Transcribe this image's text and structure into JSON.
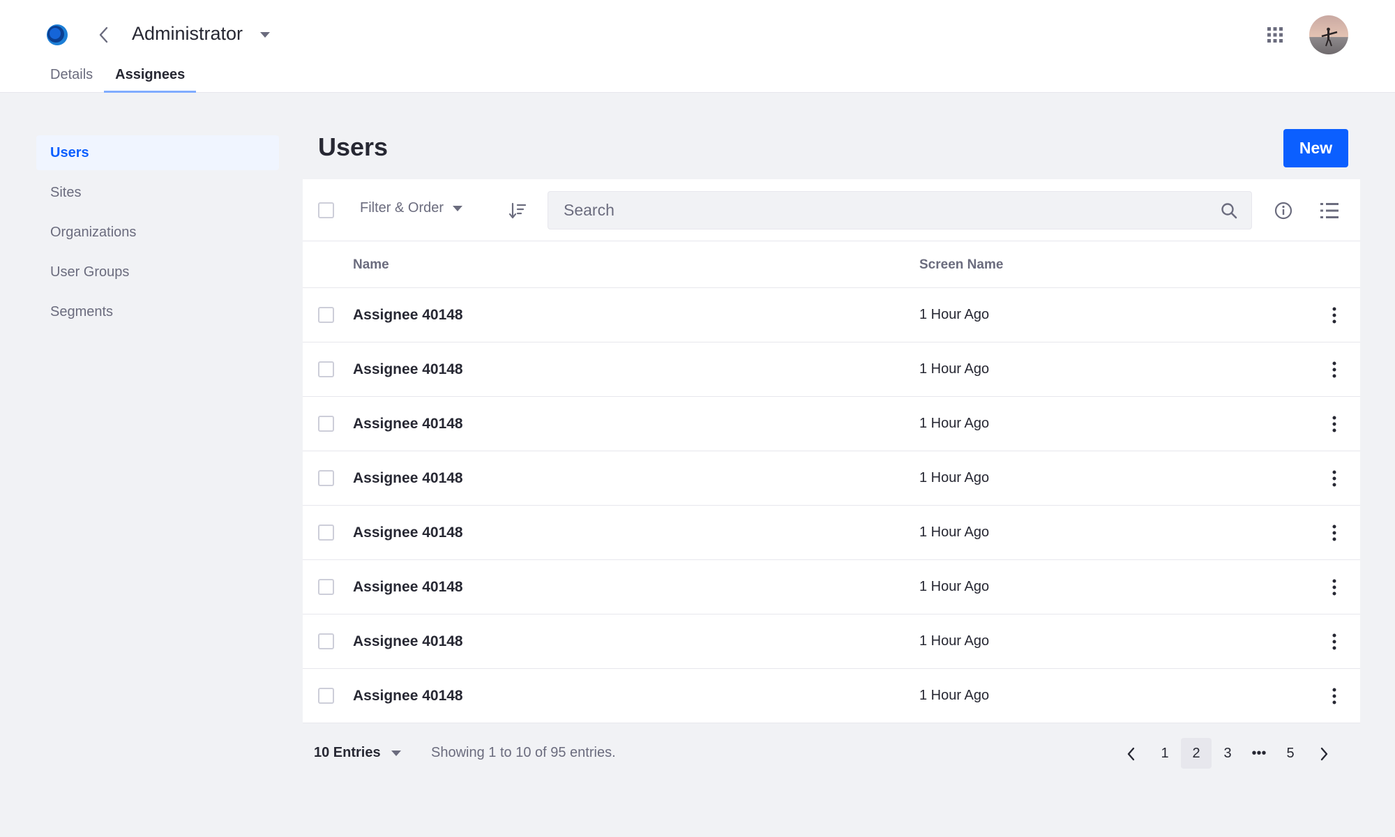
{
  "header": {
    "title": "Administrator",
    "tabs": [
      {
        "label": "Details",
        "active": false
      },
      {
        "label": "Assignees",
        "active": true
      }
    ]
  },
  "sidebar": {
    "items": [
      {
        "label": "Users",
        "active": true
      },
      {
        "label": "Sites",
        "active": false
      },
      {
        "label": "Organizations",
        "active": false
      },
      {
        "label": "User Groups",
        "active": false
      },
      {
        "label": "Segments",
        "active": false
      }
    ]
  },
  "main": {
    "title": "Users",
    "new_label": "New",
    "filter_label": "Filter & Order",
    "search_placeholder": "Search",
    "columns": {
      "name": "Name",
      "screen_name": "Screen Name"
    },
    "rows": [
      {
        "name": "Assignee 40148",
        "screen_name": "1 Hour Ago"
      },
      {
        "name": "Assignee 40148",
        "screen_name": "1 Hour Ago"
      },
      {
        "name": "Assignee 40148",
        "screen_name": "1 Hour Ago"
      },
      {
        "name": "Assignee 40148",
        "screen_name": "1 Hour Ago"
      },
      {
        "name": "Assignee 40148",
        "screen_name": "1 Hour Ago"
      },
      {
        "name": "Assignee 40148",
        "screen_name": "1 Hour Ago"
      },
      {
        "name": "Assignee 40148",
        "screen_name": "1 Hour Ago"
      },
      {
        "name": "Assignee 40148",
        "screen_name": "1 Hour Ago"
      }
    ]
  },
  "pagination": {
    "entries_label": "10 Entries",
    "showing_text": "Showing 1 to 10 of 95 entries.",
    "pages": [
      "1",
      "2",
      "3",
      "5"
    ],
    "current_page": "2",
    "ellipsis": "•••"
  },
  "colors": {
    "accent": "#0b5fff",
    "tab_underline": "#80acff",
    "background": "#f1f2f5"
  },
  "icons": [
    "liferay-logo-icon",
    "chevron-left-icon",
    "caret-down-icon",
    "apps-grid-icon",
    "avatar",
    "sort-icon",
    "search-icon",
    "info-icon",
    "list-view-icon",
    "ellipsis-vertical-icon",
    "chevron-right-icon"
  ]
}
